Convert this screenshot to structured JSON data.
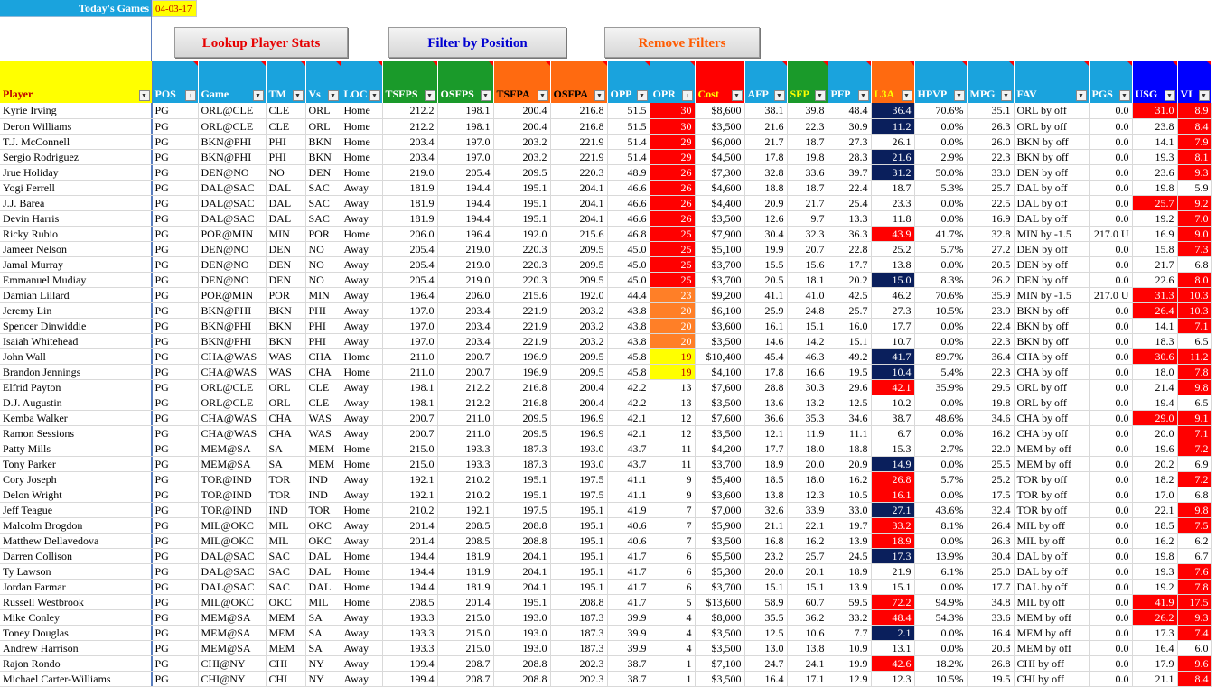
{
  "top": {
    "games_label": "Today's Games",
    "date": "04-03-17"
  },
  "buttons": {
    "lookup": "Lookup Player Stats",
    "filter": "Filter by Position",
    "remove": "Remove Filters"
  },
  "colors": {
    "red": "#ff0000",
    "orange": "#ff7f27",
    "yellow": "#ffff00",
    "navy": "#0a1f5c",
    "lightblue": "#1aa3dd",
    "green": "#1a9a2a",
    "deeporange": "#ff6a10",
    "blue": "#0000ff"
  },
  "columns": [
    {
      "label": "Player",
      "bg": "#ffff00",
      "fg": "#c00000"
    },
    {
      "label": "POS",
      "bg": "#1aa3dd",
      "sort": true
    },
    {
      "label": "Game",
      "bg": "#1aa3dd"
    },
    {
      "label": "TM",
      "bg": "#1aa3dd"
    },
    {
      "label": "Vs",
      "bg": "#1aa3dd"
    },
    {
      "label": "LOC",
      "bg": "#1aa3dd"
    },
    {
      "label": "TSFPS",
      "bg": "#1a9a2a"
    },
    {
      "label": "OSFPS",
      "bg": "#1a9a2a"
    },
    {
      "label": "TSFPA",
      "bg": "#ff6a10",
      "fg": "#000000"
    },
    {
      "label": "OSFPA",
      "bg": "#ff6a10",
      "fg": "#000000"
    },
    {
      "label": "OPP",
      "bg": "#1aa3dd"
    },
    {
      "label": "OPR",
      "bg": "#1aa3dd",
      "sort": true
    },
    {
      "label": "Cost",
      "bg": "#ff0000",
      "fg": "#ffff00"
    },
    {
      "label": "AFP",
      "bg": "#1aa3dd"
    },
    {
      "label": "SFP",
      "bg": "#1a9a2a",
      "fg": "#ffff00"
    },
    {
      "label": "PFP",
      "bg": "#1aa3dd"
    },
    {
      "label": "L3A",
      "bg": "#ff6a10",
      "fg": "#ffff00"
    },
    {
      "label": "HPVP",
      "bg": "#1aa3dd"
    },
    {
      "label": "MPG",
      "bg": "#1aa3dd"
    },
    {
      "label": "FAV",
      "bg": "#1aa3dd"
    },
    {
      "label": "PGS",
      "bg": "#1aa3dd"
    },
    {
      "label": "USG",
      "bg": "#0000ff"
    },
    {
      "label": "VI",
      "bg": "#0000ff"
    }
  ],
  "rows": [
    [
      "Kyrie Irving",
      "PG",
      "ORL@CLE",
      "CLE",
      "ORL",
      "Home",
      "212.2",
      "198.1",
      "200.4",
      "216.8",
      "51.5",
      "30",
      "$8,600",
      "38.1",
      "39.8",
      "48.4",
      "36.4",
      "70.6%",
      "35.1",
      "ORL by off",
      "0.0",
      "31.0",
      "8.9"
    ],
    [
      "Deron Williams",
      "PG",
      "ORL@CLE",
      "CLE",
      "ORL",
      "Home",
      "212.2",
      "198.1",
      "200.4",
      "216.8",
      "51.5",
      "30",
      "$3,500",
      "21.6",
      "22.3",
      "30.9",
      "11.2",
      "0.0%",
      "26.3",
      "ORL by off",
      "0.0",
      "23.8",
      "8.4"
    ],
    [
      "T.J. McConnell",
      "PG",
      "BKN@PHI",
      "PHI",
      "BKN",
      "Home",
      "203.4",
      "197.0",
      "203.2",
      "221.9",
      "51.4",
      "29",
      "$6,000",
      "21.7",
      "18.7",
      "27.3",
      "26.1",
      "0.0%",
      "26.0",
      "BKN by off",
      "0.0",
      "14.1",
      "7.9"
    ],
    [
      "Sergio Rodriguez",
      "PG",
      "BKN@PHI",
      "PHI",
      "BKN",
      "Home",
      "203.4",
      "197.0",
      "203.2",
      "221.9",
      "51.4",
      "29",
      "$4,500",
      "17.8",
      "19.8",
      "28.3",
      "21.6",
      "2.9%",
      "22.3",
      "BKN by off",
      "0.0",
      "19.3",
      "8.1"
    ],
    [
      "Jrue Holiday",
      "PG",
      "DEN@NO",
      "NO",
      "DEN",
      "Home",
      "219.0",
      "205.4",
      "209.5",
      "220.3",
      "48.9",
      "26",
      "$7,300",
      "32.8",
      "33.6",
      "39.7",
      "31.2",
      "50.0%",
      "33.0",
      "DEN by off",
      "0.0",
      "23.6",
      "9.3"
    ],
    [
      "Yogi Ferrell",
      "PG",
      "DAL@SAC",
      "DAL",
      "SAC",
      "Away",
      "181.9",
      "194.4",
      "195.1",
      "204.1",
      "46.6",
      "26",
      "$4,600",
      "18.8",
      "18.7",
      "22.4",
      "18.7",
      "5.3%",
      "25.7",
      "DAL by off",
      "0.0",
      "19.8",
      "5.9"
    ],
    [
      "J.J. Barea",
      "PG",
      "DAL@SAC",
      "DAL",
      "SAC",
      "Away",
      "181.9",
      "194.4",
      "195.1",
      "204.1",
      "46.6",
      "26",
      "$4,400",
      "20.9",
      "21.7",
      "25.4",
      "23.3",
      "0.0%",
      "22.5",
      "DAL by off",
      "0.0",
      "25.7",
      "9.2"
    ],
    [
      "Devin Harris",
      "PG",
      "DAL@SAC",
      "DAL",
      "SAC",
      "Away",
      "181.9",
      "194.4",
      "195.1",
      "204.1",
      "46.6",
      "26",
      "$3,500",
      "12.6",
      "9.7",
      "13.3",
      "11.8",
      "0.0%",
      "16.9",
      "DAL by off",
      "0.0",
      "19.2",
      "7.0"
    ],
    [
      "Ricky Rubio",
      "PG",
      "POR@MIN",
      "MIN",
      "POR",
      "Home",
      "206.0",
      "196.4",
      "192.0",
      "215.6",
      "46.8",
      "25",
      "$7,900",
      "30.4",
      "32.3",
      "36.3",
      "43.9",
      "41.7%",
      "32.8",
      "MIN by -1.5",
      "217.0 U",
      "16.9",
      "9.0"
    ],
    [
      "Jameer Nelson",
      "PG",
      "DEN@NO",
      "DEN",
      "NO",
      "Away",
      "205.4",
      "219.0",
      "220.3",
      "209.5",
      "45.0",
      "25",
      "$5,100",
      "19.9",
      "20.7",
      "22.8",
      "25.2",
      "5.7%",
      "27.2",
      "DEN by off",
      "0.0",
      "15.8",
      "7.3"
    ],
    [
      "Jamal Murray",
      "PG",
      "DEN@NO",
      "DEN",
      "NO",
      "Away",
      "205.4",
      "219.0",
      "220.3",
      "209.5",
      "45.0",
      "25",
      "$3,700",
      "15.5",
      "15.6",
      "17.7",
      "13.8",
      "0.0%",
      "20.5",
      "DEN by off",
      "0.0",
      "21.7",
      "6.8"
    ],
    [
      "Emmanuel Mudiay",
      "PG",
      "DEN@NO",
      "DEN",
      "NO",
      "Away",
      "205.4",
      "219.0",
      "220.3",
      "209.5",
      "45.0",
      "25",
      "$3,700",
      "20.5",
      "18.1",
      "20.2",
      "15.0",
      "8.3%",
      "26.2",
      "DEN by off",
      "0.0",
      "22.6",
      "8.0"
    ],
    [
      "Damian Lillard",
      "PG",
      "POR@MIN",
      "POR",
      "MIN",
      "Away",
      "196.4",
      "206.0",
      "215.6",
      "192.0",
      "44.4",
      "23",
      "$9,200",
      "41.1",
      "41.0",
      "42.5",
      "46.2",
      "70.6%",
      "35.9",
      "MIN by -1.5",
      "217.0 U",
      "31.3",
      "10.3"
    ],
    [
      "Jeremy Lin",
      "PG",
      "BKN@PHI",
      "BKN",
      "PHI",
      "Away",
      "197.0",
      "203.4",
      "221.9",
      "203.2",
      "43.8",
      "20",
      "$6,100",
      "25.9",
      "24.8",
      "25.7",
      "27.3",
      "10.5%",
      "23.9",
      "BKN by off",
      "0.0",
      "26.4",
      "10.3"
    ],
    [
      "Spencer Dinwiddie",
      "PG",
      "BKN@PHI",
      "BKN",
      "PHI",
      "Away",
      "197.0",
      "203.4",
      "221.9",
      "203.2",
      "43.8",
      "20",
      "$3,600",
      "16.1",
      "15.1",
      "16.0",
      "17.7",
      "0.0%",
      "22.4",
      "BKN by off",
      "0.0",
      "14.1",
      "7.1"
    ],
    [
      "Isaiah Whitehead",
      "PG",
      "BKN@PHI",
      "BKN",
      "PHI",
      "Away",
      "197.0",
      "203.4",
      "221.9",
      "203.2",
      "43.8",
      "20",
      "$3,500",
      "14.6",
      "14.2",
      "15.1",
      "10.7",
      "0.0%",
      "22.3",
      "BKN by off",
      "0.0",
      "18.3",
      "6.5"
    ],
    [
      "John Wall",
      "PG",
      "CHA@WAS",
      "WAS",
      "CHA",
      "Home",
      "211.0",
      "200.7",
      "196.9",
      "209.5",
      "45.8",
      "19",
      "$10,400",
      "45.4",
      "46.3",
      "49.2",
      "41.7",
      "89.7%",
      "36.4",
      "CHA by off",
      "0.0",
      "30.6",
      "11.2"
    ],
    [
      "Brandon Jennings",
      "PG",
      "CHA@WAS",
      "WAS",
      "CHA",
      "Home",
      "211.0",
      "200.7",
      "196.9",
      "209.5",
      "45.8",
      "19",
      "$4,100",
      "17.8",
      "16.6",
      "19.5",
      "10.4",
      "5.4%",
      "22.3",
      "CHA by off",
      "0.0",
      "18.0",
      "7.8"
    ],
    [
      "Elfrid Payton",
      "PG",
      "ORL@CLE",
      "ORL",
      "CLE",
      "Away",
      "198.1",
      "212.2",
      "216.8",
      "200.4",
      "42.2",
      "13",
      "$7,600",
      "28.8",
      "30.3",
      "29.6",
      "42.1",
      "35.9%",
      "29.5",
      "ORL by off",
      "0.0",
      "21.4",
      "9.8"
    ],
    [
      "D.J. Augustin",
      "PG",
      "ORL@CLE",
      "ORL",
      "CLE",
      "Away",
      "198.1",
      "212.2",
      "216.8",
      "200.4",
      "42.2",
      "13",
      "$3,500",
      "13.6",
      "13.2",
      "12.5",
      "10.2",
      "0.0%",
      "19.8",
      "ORL by off",
      "0.0",
      "19.4",
      "6.5"
    ],
    [
      "Kemba Walker",
      "PG",
      "CHA@WAS",
      "CHA",
      "WAS",
      "Away",
      "200.7",
      "211.0",
      "209.5",
      "196.9",
      "42.1",
      "12",
      "$7,600",
      "36.6",
      "35.3",
      "34.6",
      "38.7",
      "48.6%",
      "34.6",
      "CHA by off",
      "0.0",
      "29.0",
      "9.1"
    ],
    [
      "Ramon Sessions",
      "PG",
      "CHA@WAS",
      "CHA",
      "WAS",
      "Away",
      "200.7",
      "211.0",
      "209.5",
      "196.9",
      "42.1",
      "12",
      "$3,500",
      "12.1",
      "11.9",
      "11.1",
      "6.7",
      "0.0%",
      "16.2",
      "CHA by off",
      "0.0",
      "20.0",
      "7.1"
    ],
    [
      "Patty Mills",
      "PG",
      "MEM@SA",
      "SA",
      "MEM",
      "Home",
      "215.0",
      "193.3",
      "187.3",
      "193.0",
      "43.7",
      "11",
      "$4,200",
      "17.7",
      "18.0",
      "18.8",
      "15.3",
      "2.7%",
      "22.0",
      "MEM by off",
      "0.0",
      "19.6",
      "7.2"
    ],
    [
      "Tony Parker",
      "PG",
      "MEM@SA",
      "SA",
      "MEM",
      "Home",
      "215.0",
      "193.3",
      "187.3",
      "193.0",
      "43.7",
      "11",
      "$3,700",
      "18.9",
      "20.0",
      "20.9",
      "14.9",
      "0.0%",
      "25.5",
      "MEM by off",
      "0.0",
      "20.2",
      "6.9"
    ],
    [
      "Cory Joseph",
      "PG",
      "TOR@IND",
      "TOR",
      "IND",
      "Away",
      "192.1",
      "210.2",
      "195.1",
      "197.5",
      "41.1",
      "9",
      "$5,400",
      "18.5",
      "18.0",
      "16.2",
      "26.8",
      "5.7%",
      "25.2",
      "TOR by off",
      "0.0",
      "18.2",
      "7.2"
    ],
    [
      "Delon Wright",
      "PG",
      "TOR@IND",
      "TOR",
      "IND",
      "Away",
      "192.1",
      "210.2",
      "195.1",
      "197.5",
      "41.1",
      "9",
      "$3,600",
      "13.8",
      "12.3",
      "10.5",
      "16.1",
      "0.0%",
      "17.5",
      "TOR by off",
      "0.0",
      "17.0",
      "6.8"
    ],
    [
      "Jeff Teague",
      "PG",
      "TOR@IND",
      "IND",
      "TOR",
      "Home",
      "210.2",
      "192.1",
      "197.5",
      "195.1",
      "41.9",
      "7",
      "$7,000",
      "32.6",
      "33.9",
      "33.0",
      "27.1",
      "43.6%",
      "32.4",
      "TOR by off",
      "0.0",
      "22.1",
      "9.8"
    ],
    [
      "Malcolm Brogdon",
      "PG",
      "MIL@OKC",
      "MIL",
      "OKC",
      "Away",
      "201.4",
      "208.5",
      "208.8",
      "195.1",
      "40.6",
      "7",
      "$5,900",
      "21.1",
      "22.1",
      "19.7",
      "33.2",
      "8.1%",
      "26.4",
      "MIL by off",
      "0.0",
      "18.5",
      "7.5"
    ],
    [
      "Matthew Dellavedova",
      "PG",
      "MIL@OKC",
      "MIL",
      "OKC",
      "Away",
      "201.4",
      "208.5",
      "208.8",
      "195.1",
      "40.6",
      "7",
      "$3,500",
      "16.8",
      "16.2",
      "13.9",
      "18.9",
      "0.0%",
      "26.3",
      "MIL by off",
      "0.0",
      "16.2",
      "6.2"
    ],
    [
      "Darren Collison",
      "PG",
      "DAL@SAC",
      "SAC",
      "DAL",
      "Home",
      "194.4",
      "181.9",
      "204.1",
      "195.1",
      "41.7",
      "6",
      "$5,500",
      "23.2",
      "25.7",
      "24.5",
      "17.3",
      "13.9%",
      "30.4",
      "DAL by off",
      "0.0",
      "19.8",
      "6.7"
    ],
    [
      "Ty Lawson",
      "PG",
      "DAL@SAC",
      "SAC",
      "DAL",
      "Home",
      "194.4",
      "181.9",
      "204.1",
      "195.1",
      "41.7",
      "6",
      "$5,300",
      "20.0",
      "20.1",
      "18.9",
      "21.9",
      "6.1%",
      "25.0",
      "DAL by off",
      "0.0",
      "19.3",
      "7.6"
    ],
    [
      "Jordan Farmar",
      "PG",
      "DAL@SAC",
      "SAC",
      "DAL",
      "Home",
      "194.4",
      "181.9",
      "204.1",
      "195.1",
      "41.7",
      "6",
      "$3,700",
      "15.1",
      "15.1",
      "13.9",
      "15.1",
      "0.0%",
      "17.7",
      "DAL by off",
      "0.0",
      "19.2",
      "7.8"
    ],
    [
      "Russell Westbrook",
      "PG",
      "MIL@OKC",
      "OKC",
      "MIL",
      "Home",
      "208.5",
      "201.4",
      "195.1",
      "208.8",
      "41.7",
      "5",
      "$13,600",
      "58.9",
      "60.7",
      "59.5",
      "72.2",
      "94.9%",
      "34.8",
      "MIL by off",
      "0.0",
      "41.9",
      "17.5"
    ],
    [
      "Mike Conley",
      "PG",
      "MEM@SA",
      "MEM",
      "SA",
      "Away",
      "193.3",
      "215.0",
      "193.0",
      "187.3",
      "39.9",
      "4",
      "$8,000",
      "35.5",
      "36.2",
      "33.2",
      "48.4",
      "54.3%",
      "33.6",
      "MEM by off",
      "0.0",
      "26.2",
      "9.3"
    ],
    [
      "Toney Douglas",
      "PG",
      "MEM@SA",
      "MEM",
      "SA",
      "Away",
      "193.3",
      "215.0",
      "193.0",
      "187.3",
      "39.9",
      "4",
      "$3,500",
      "12.5",
      "10.6",
      "7.7",
      "2.1",
      "0.0%",
      "16.4",
      "MEM by off",
      "0.0",
      "17.3",
      "7.4"
    ],
    [
      "Andrew Harrison",
      "PG",
      "MEM@SA",
      "MEM",
      "SA",
      "Away",
      "193.3",
      "215.0",
      "193.0",
      "187.3",
      "39.9",
      "4",
      "$3,500",
      "13.0",
      "13.8",
      "10.9",
      "13.1",
      "0.0%",
      "20.3",
      "MEM by off",
      "0.0",
      "16.4",
      "6.0"
    ],
    [
      "Rajon Rondo",
      "PG",
      "CHI@NY",
      "CHI",
      "NY",
      "Away",
      "199.4",
      "208.7",
      "208.8",
      "202.3",
      "38.7",
      "1",
      "$7,100",
      "24.7",
      "24.1",
      "19.9",
      "42.6",
      "18.2%",
      "26.8",
      "CHI by off",
      "0.0",
      "17.9",
      "9.6"
    ],
    [
      "Michael Carter-Williams",
      "PG",
      "CHI@NY",
      "CHI",
      "NY",
      "Away",
      "199.4",
      "208.7",
      "208.8",
      "202.3",
      "38.7",
      "1",
      "$3,500",
      "16.4",
      "17.1",
      "12.9",
      "12.3",
      "10.5%",
      "19.5",
      "CHI by off",
      "0.0",
      "21.1",
      "8.4"
    ]
  ]
}
